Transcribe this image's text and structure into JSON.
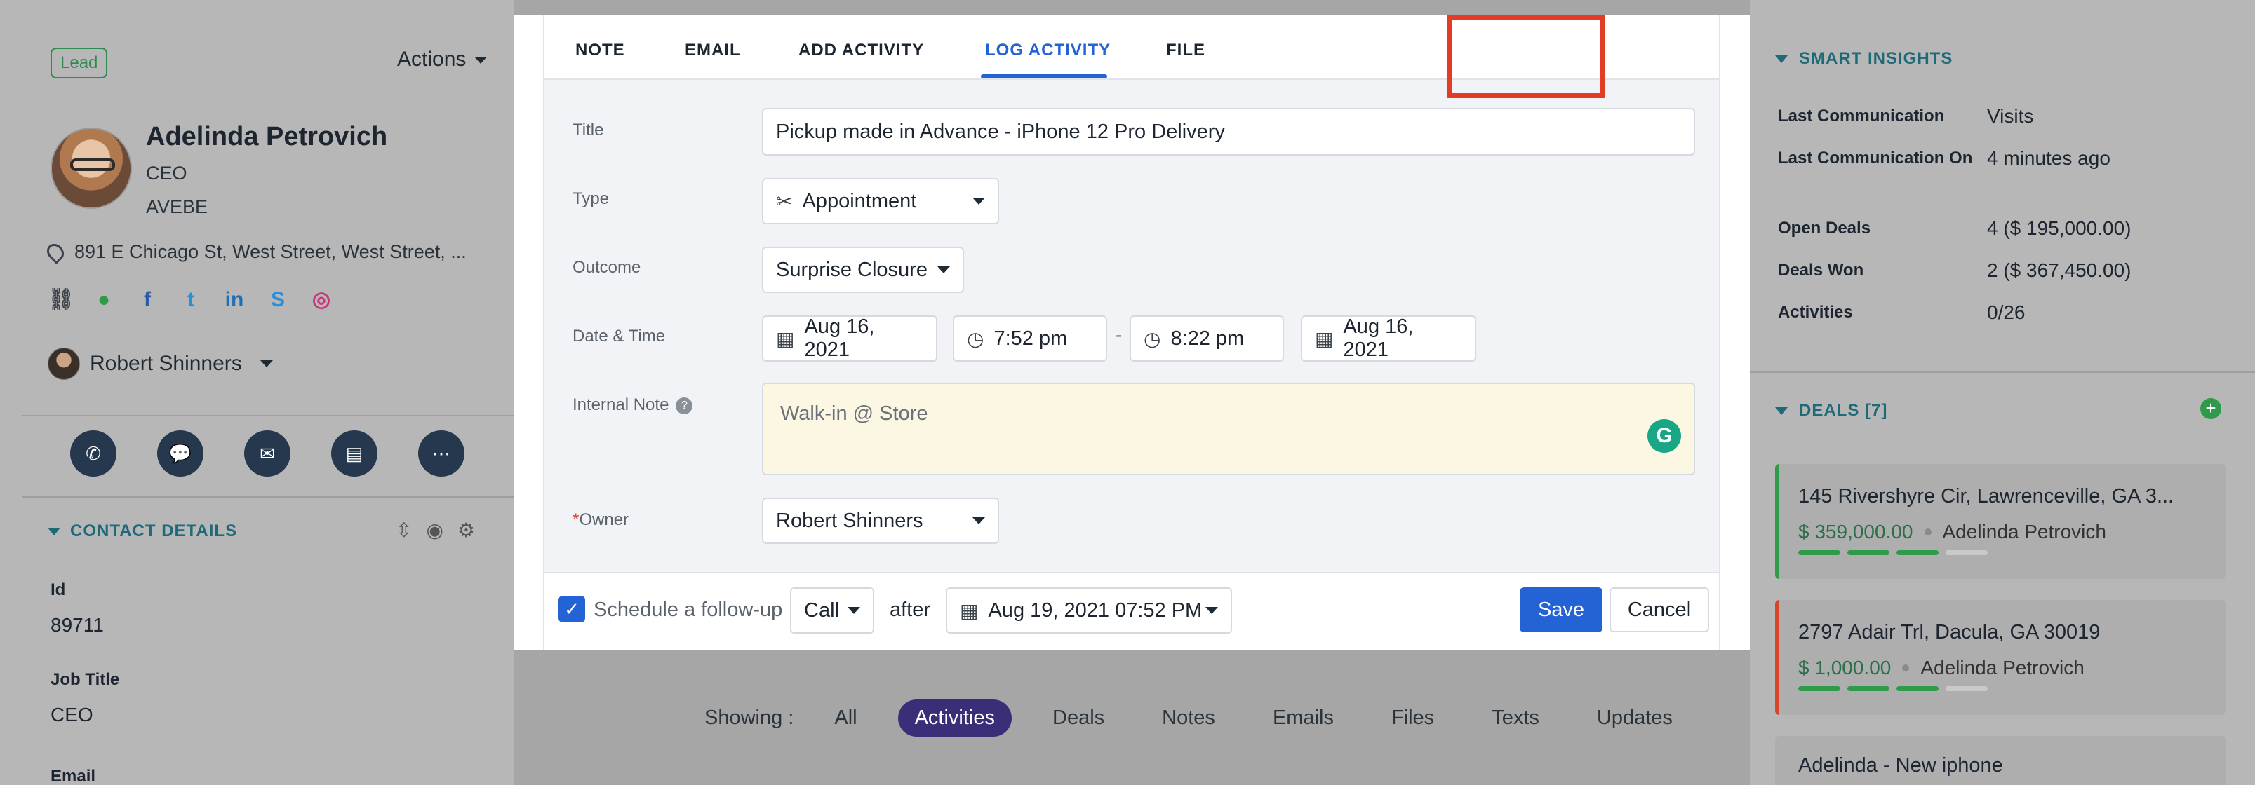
{
  "contact": {
    "badge": "Lead",
    "actions_label": "Actions",
    "name": "Adelinda Petrovich",
    "title": "CEO",
    "company": "AVEBE",
    "address": "891 E Chicago St, West Street, West Street, ...",
    "owner": "Robert Shinners",
    "social_icons": [
      "link-icon",
      "globe-icon",
      "facebook-icon",
      "twitter-icon",
      "linkedin-icon",
      "skype-icon",
      "instagram-icon"
    ],
    "quick_actions": [
      "phone-icon",
      "chat-icon",
      "email-icon",
      "inbox-icon",
      "more-icon"
    ]
  },
  "contact_details": {
    "heading": "CONTACT DETAILS",
    "fields": [
      {
        "label": "Id",
        "value": "89711"
      },
      {
        "label": "Job Title",
        "value": "CEO"
      },
      {
        "label": "Email",
        "value": ""
      }
    ]
  },
  "modal": {
    "tabs": [
      "NOTE",
      "EMAIL",
      "ADD ACTIVITY",
      "LOG ACTIVITY",
      "FILE"
    ],
    "active_tab": "LOG ACTIVITY",
    "form": {
      "title_label": "Title",
      "title_value": "Pickup made in Advance - iPhone 12 Pro Delivery",
      "type_label": "Type",
      "type_value": "Appointment",
      "outcome_label": "Outcome",
      "outcome_value": "Surprise Closure",
      "datetime_label": "Date & Time",
      "start_date": "Aug 16, 2021",
      "start_time": "7:52 pm",
      "separator": "-",
      "end_time": "8:22 pm",
      "end_date": "Aug 16, 2021",
      "note_label": "Internal Note",
      "note_placeholder": "Walk-in @ Store",
      "owner_required": "*",
      "owner_label": "Owner",
      "owner_value": "Robert Shinners"
    },
    "footer": {
      "followup_label": "Schedule a follow-up",
      "followup_type": "Call",
      "after_label": "after",
      "followup_datetime": "Aug 19, 2021 07:52 PM",
      "save_label": "Save",
      "cancel_label": "Cancel"
    }
  },
  "showing": {
    "label": "Showing :",
    "filters": [
      "All",
      "Activities",
      "Deals",
      "Notes",
      "Emails",
      "Files",
      "Texts",
      "Updates"
    ],
    "active": "Activities"
  },
  "insights": {
    "heading": "SMART INSIGHTS",
    "rows": [
      {
        "label": "Last Communication",
        "value": "Visits"
      },
      {
        "label": "Last Communication On",
        "value": "4 minutes ago"
      },
      {
        "label": "Open Deals",
        "value": "4 ($ 195,000.00)"
      },
      {
        "label": "Deals Won",
        "value": "2 ($ 367,450.00)"
      },
      {
        "label": "Activities",
        "value": "0/26"
      }
    ]
  },
  "deals": {
    "heading": "DEALS [7]",
    "items": [
      {
        "title": "145 Rivershyre Cir, Lawrenceville, GA 3...",
        "amount": "$ 359,000.00",
        "person": "Adelinda Petrovich",
        "accent": "#2e9a4a",
        "progress": 0.75
      },
      {
        "title": "2797 Adair Trl, Dacula, GA 30019",
        "amount": "$ 1,000.00",
        "person": "Adelinda Petrovich",
        "accent": "#d9452b",
        "progress": 0.75
      },
      {
        "title": "Adelinda - New iphone",
        "amount": "",
        "person": "",
        "accent": "#b7b7b7",
        "progress": 0
      }
    ]
  },
  "colors": {
    "primary": "#2463d6",
    "active_chip": "#3a2e78",
    "highlight": "#e43b25",
    "teal_heading": "#1e6a78",
    "success": "#2e9a4a"
  }
}
